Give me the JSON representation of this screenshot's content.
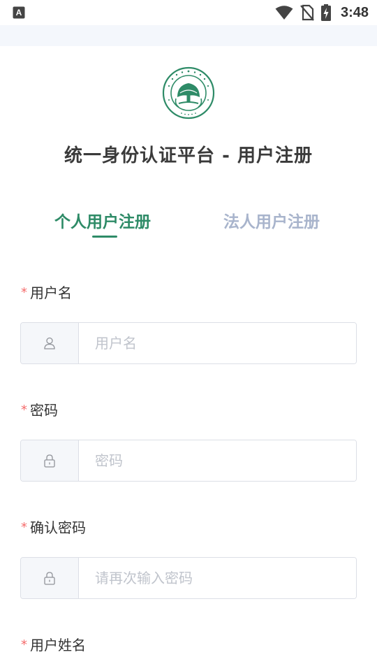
{
  "status_bar": {
    "time": "3:48",
    "icons": [
      "keyboard-a-icon",
      "wifi-icon",
      "no-sim-icon",
      "battery-charging-icon"
    ]
  },
  "header": {
    "title": "统一身份认证平台 - 用户注册"
  },
  "tabs": [
    {
      "label": "个人用户注册",
      "active": true
    },
    {
      "label": "法人用户注册",
      "active": false
    }
  ],
  "form": {
    "required_mark": "*",
    "fields": [
      {
        "label": "用户名",
        "placeholder": "用户名",
        "value": "",
        "icon": "user-icon"
      },
      {
        "label": "密码",
        "placeholder": "密码",
        "value": "",
        "icon": "lock-icon"
      },
      {
        "label": "确认密码",
        "placeholder": "请再次输入密码",
        "value": "",
        "icon": "lock-icon"
      },
      {
        "label": "用户姓名"
      }
    ]
  },
  "colors": {
    "accent": "#2e8b67",
    "inactive_tab": "#a8b4cc",
    "required": "#f56c6c",
    "placeholder": "#c0c4cc",
    "border": "#dcdfe6"
  }
}
